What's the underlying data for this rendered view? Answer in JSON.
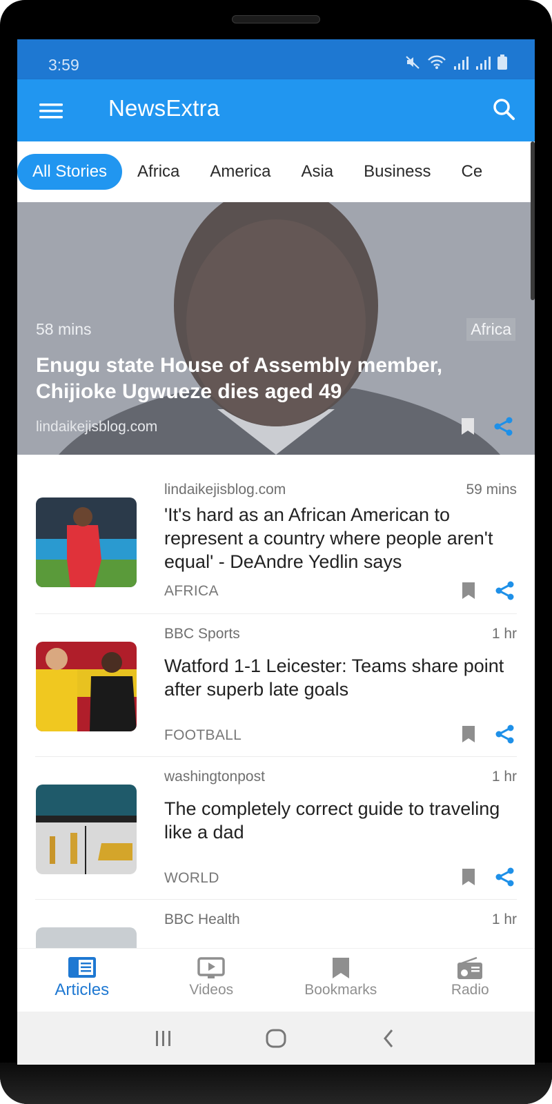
{
  "status_bar": {
    "time": "3:59",
    "icons": [
      "mute-icon",
      "wifi-icon",
      "signal-icon",
      "signal-icon",
      "battery-icon"
    ]
  },
  "app_bar": {
    "title": "NewsExtra",
    "menu_icon": "hamburger-menu-icon",
    "search_icon": "search-icon"
  },
  "tabs": [
    {
      "label": "All Stories",
      "active": true
    },
    {
      "label": "Africa",
      "active": false
    },
    {
      "label": "America",
      "active": false
    },
    {
      "label": "Asia",
      "active": false
    },
    {
      "label": "Business",
      "active": false
    },
    {
      "label": "Ce",
      "active": false
    }
  ],
  "hero": {
    "time": "58 mins",
    "tag": "Africa",
    "title": "Enugu state House of Assembly member, Chijioke Ugwueze dies aged 49",
    "source": "lindaikejisblog.com"
  },
  "articles": [
    {
      "source": "lindaikejisblog.com",
      "time": "59 mins",
      "title": "'It's hard as an African American to represent a country where people aren't equal' - DeAndre Yedlin says",
      "category": "AFRICA"
    },
    {
      "source": "BBC Sports",
      "time": "1 hr",
      "title": "Watford 1-1 Leicester: Teams share point after superb late goals",
      "category": "FOOTBALL"
    },
    {
      "source": "washingtonpost",
      "time": "1 hr",
      "title": "The completely correct guide to traveling like a dad",
      "category": "WORLD"
    },
    {
      "source": "BBC Health",
      "time": "1 hr",
      "title": "",
      "category": ""
    }
  ],
  "bottom_nav": [
    {
      "label": "Articles",
      "icon": "articles-icon",
      "active": true
    },
    {
      "label": "Videos",
      "icon": "video-icon",
      "active": false
    },
    {
      "label": "Bookmarks",
      "icon": "bookmark-icon",
      "active": false
    },
    {
      "label": "Radio",
      "icon": "radio-icon",
      "active": false
    }
  ],
  "system_nav": [
    "recent-apps-icon",
    "home-icon",
    "back-icon"
  ],
  "colors": {
    "primary": "#2196f0",
    "status_bar": "#1e78d2",
    "accent_share": "#1e90e8",
    "inactive": "#8f8f8f"
  }
}
